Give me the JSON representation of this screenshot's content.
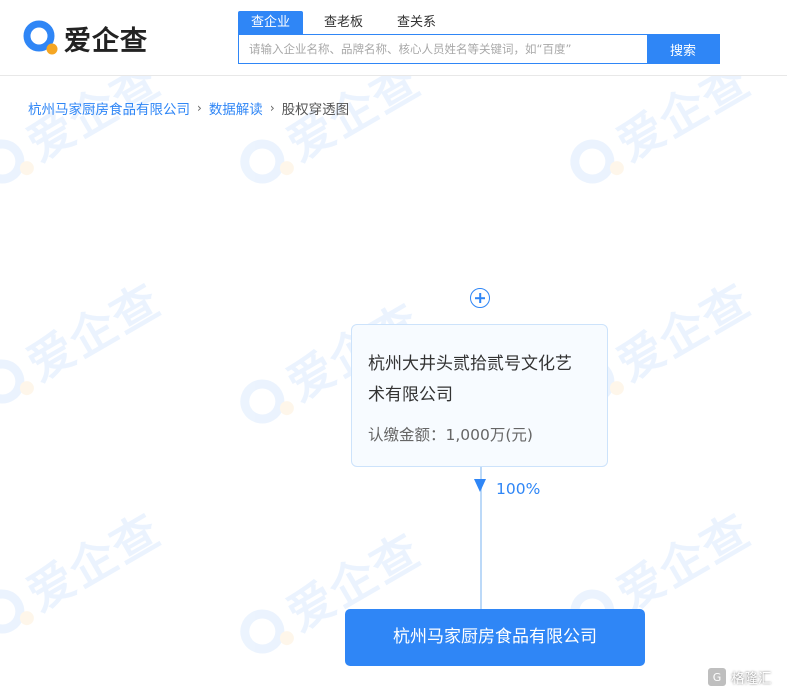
{
  "header": {
    "logo_text": "爱企查",
    "tabs": [
      {
        "label": "查企业",
        "active": true
      },
      {
        "label": "查老板",
        "active": false
      },
      {
        "label": "查关系",
        "active": false
      }
    ],
    "search": {
      "placeholder": "请输入企业名称、品牌名称、核心人员姓名等关键词，如“百度”",
      "button_label": "搜索"
    }
  },
  "breadcrumb": {
    "items": [
      {
        "label": "杭州马家厨房食品有限公司",
        "link": true
      },
      {
        "label": "数据解读",
        "link": true
      },
      {
        "label": "股权穿透图",
        "link": false
      }
    ],
    "separator": "›"
  },
  "graph": {
    "shareholder": {
      "name_line1": "杭州大井头贰拾贰号文化艺",
      "name_line2": "术有限公司",
      "amount_label": "认缴金额：",
      "amount_value": "1,000万(元)"
    },
    "share_percent": "100%",
    "company": {
      "name": "杭州马家厨房食品有限公司"
    }
  },
  "watermark": {
    "text": "爱企查"
  },
  "corner_brand": {
    "icon_letter": "G",
    "text": "格隆汇"
  },
  "colors": {
    "primary": "#2f86f6",
    "node_border": "#cde3fb",
    "node_bg": "#f7fbff",
    "logo_accent": "#f5a623"
  }
}
